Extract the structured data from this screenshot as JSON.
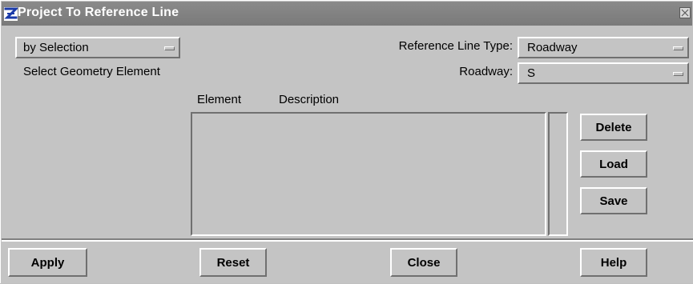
{
  "window": {
    "title": "Project To Reference Line"
  },
  "controls": {
    "mode_select": {
      "value": "by Selection"
    },
    "instruction": "Select Geometry Element",
    "ref_line_type": {
      "label": "Reference Line Type:",
      "value": "Roadway"
    },
    "roadway": {
      "label": "Roadway:",
      "value": "S"
    }
  },
  "list": {
    "columns": [
      "Element",
      "Description"
    ],
    "rows": []
  },
  "side_buttons": {
    "delete": "Delete",
    "load": "Load",
    "save": "Save"
  },
  "bottom_buttons": {
    "apply": "Apply",
    "reset": "Reset",
    "close": "Close",
    "help": "Help"
  },
  "icons": {
    "app_icon": "z-app-icon",
    "close_icon": "close-icon"
  },
  "colors": {
    "background": "#c4c4c4",
    "titlebar": "#808080",
    "title_text": "#ffffff"
  }
}
